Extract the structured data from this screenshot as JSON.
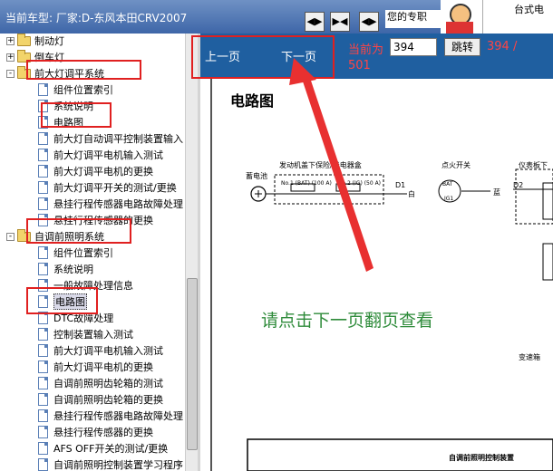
{
  "header": {
    "car_label": "当前车型:  厂家:D-东风本田CRV2007",
    "nav_buttons": [
      "◀▶",
      "▶◀",
      "◀▶"
    ],
    "profile_text": "您的专职",
    "desk_label": "台式电"
  },
  "tree": [
    {
      "label": "制动灯",
      "type": "folder",
      "expander": "+"
    },
    {
      "label": "倒车灯",
      "type": "folder",
      "expander": "+"
    },
    {
      "label": "前大灯调平系统",
      "type": "folder",
      "expander": "-"
    },
    {
      "label": "组件位置索引",
      "type": "doc"
    },
    {
      "label": "系统说明",
      "type": "doc"
    },
    {
      "label": "电路图",
      "type": "doc"
    },
    {
      "label": "前大灯自动调平控制装置输入",
      "type": "doc"
    },
    {
      "label": "前大灯调平电机输入测试",
      "type": "doc"
    },
    {
      "label": "前大灯调平电机的更换",
      "type": "doc"
    },
    {
      "label": "前大灯调平开关的测试/更换",
      "type": "doc"
    },
    {
      "label": "悬挂行程传感器电路故障处理",
      "type": "doc"
    },
    {
      "label": "悬挂行程传感器的更换",
      "type": "doc"
    },
    {
      "label": "自调前照明系统",
      "type": "folder",
      "expander": "-"
    },
    {
      "label": "组件位置索引",
      "type": "doc"
    },
    {
      "label": "系统说明",
      "type": "doc"
    },
    {
      "label": "一般故障处理信息",
      "type": "doc"
    },
    {
      "label": "电路图",
      "type": "doc",
      "selected": true
    },
    {
      "label": "DTC故障处理",
      "type": "doc"
    },
    {
      "label": "控制装置输入测试",
      "type": "doc"
    },
    {
      "label": "前大灯调平电机输入测试",
      "type": "doc"
    },
    {
      "label": "前大灯调平电机的更换",
      "type": "doc"
    },
    {
      "label": "自调前照明齿轮箱的测试",
      "type": "doc"
    },
    {
      "label": "自调前照明齿轮箱的更换",
      "type": "doc"
    },
    {
      "label": "悬挂行程传感器电路故障处理",
      "type": "doc"
    },
    {
      "label": "悬挂行程传感器的更换",
      "type": "doc"
    },
    {
      "label": "AFS OFF开关的测试/更换",
      "type": "doc"
    },
    {
      "label": "自调前照明控制装置学习程序",
      "type": "doc"
    }
  ],
  "topbar": {
    "prev": "上一页",
    "next": "下一页",
    "current_label": "当前为",
    "page_value": "394",
    "jump": "跳转",
    "total_a": "394 /",
    "total_b": "501"
  },
  "document": {
    "title": "电路图",
    "battery": "蓄电池",
    "fuse_box": "发动机盖下保险/继电器盒",
    "fuse1": "No.1 (BAT) (100 A)",
    "fuse2": "No.2 (IG) (50 A)",
    "d1": "D1",
    "white": "白",
    "ignition": "点火开关",
    "bat": "BAT",
    "ig1": "IG1",
    "blue": "蓝",
    "d2": "D2",
    "dash_fuse": "仪表板下",
    "trans": "变速箱",
    "control_unit": "自调前照明控制装置"
  },
  "hint": "请点击下一页翻页查看"
}
